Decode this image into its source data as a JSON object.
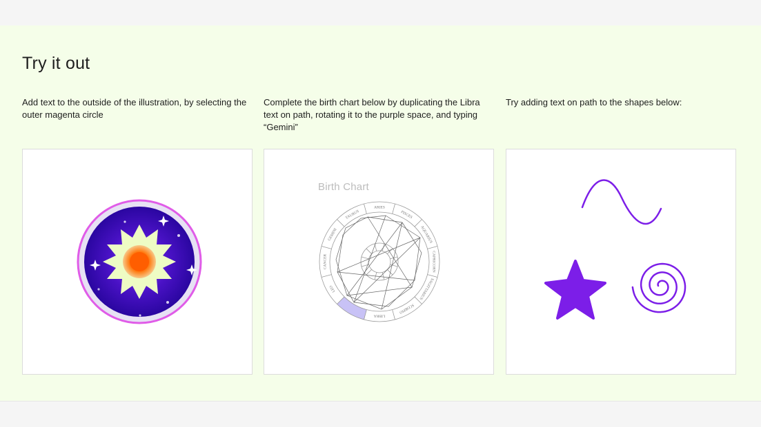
{
  "section": {
    "title": "Try it out",
    "accent_bg": "#f5fee9"
  },
  "cards": [
    {
      "instruction": "Add text to the outside of the illustration, by selecting the outer magenta circle",
      "illustration": "sun-mandala",
      "colors": {
        "ring": "#e05ce8",
        "sky": "#4b14c4",
        "star": "#eefcc4",
        "sun": "#ff6a00"
      }
    },
    {
      "instruction": "Complete the birth chart below by duplicating the Libra text on path, rotating it to the purple space, and typing “Gemini”",
      "illustration": "birth-chart",
      "chart_title": "Birth Chart",
      "signs": [
        "ARIES",
        "PISCES",
        "AQUARIUS",
        "CAPRICORN",
        "SAGITTARIUS",
        "SCORPIO",
        "LIBRA",
        "",
        "LEO",
        "CANCER",
        "GEMINI",
        "TAURUS"
      ],
      "colors": {
        "highlight": "#c8c2f6"
      }
    },
    {
      "instruction": "Try adding text on path to the shapes below:",
      "illustration": "shapes",
      "shapes": [
        "wave",
        "star",
        "spiral"
      ],
      "colors": {
        "shape": "#7c1ee8"
      }
    }
  ]
}
